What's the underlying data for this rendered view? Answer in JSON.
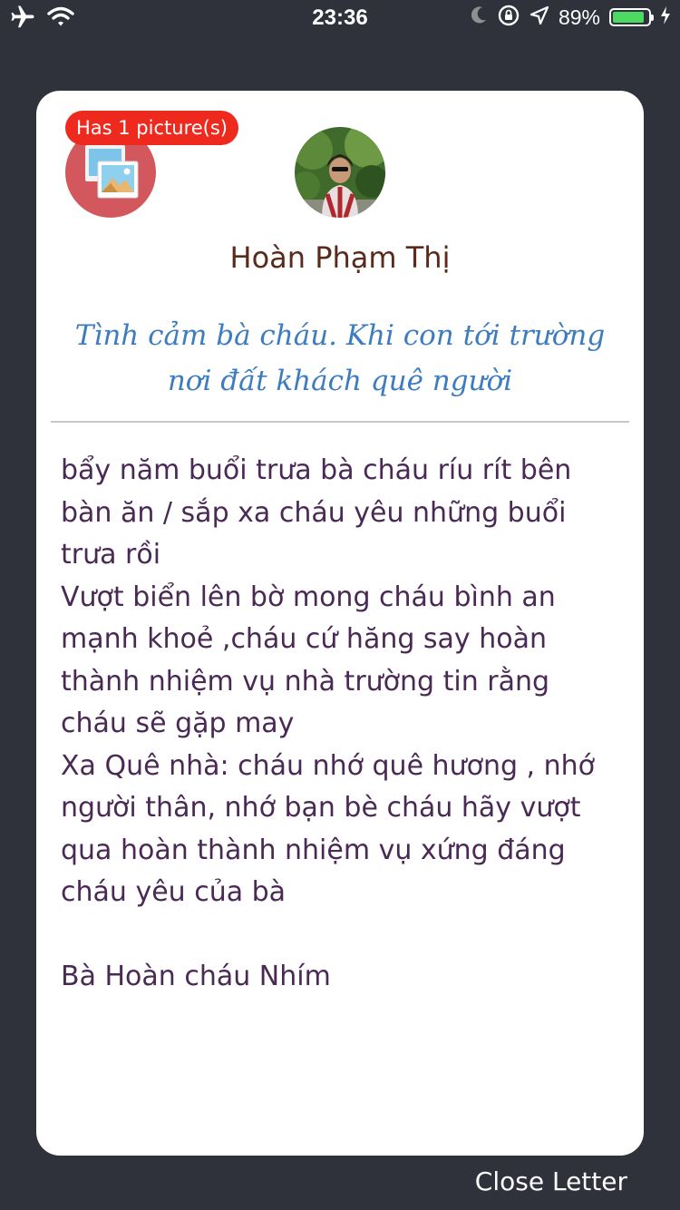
{
  "status_bar": {
    "time": "23:36",
    "battery_percent": "89%",
    "battery_level": 0.89,
    "icons": [
      "airplane-icon",
      "wifi-icon",
      "moon-icon",
      "orientation-lock-icon",
      "location-arrow-icon",
      "battery-icon",
      "charging-bolt-icon"
    ]
  },
  "letter": {
    "pictures_badge": "Has 1 picture(s)",
    "sender_name": "Hoàn Phạm Thị",
    "subject": "Tình cảm bà cháu. Khi con tới trường nơi đất khách quê người",
    "body": "bẩy năm buổi trưa bà cháu ríu rít bên bàn ăn / sắp xa cháu yêu những buổi trưa rồi\nVượt biển lên bờ mong cháu bình an mạnh khoẻ ,cháu cứ hăng say hoàn thành nhiệm vụ nhà trường tin rằng cháu sẽ gặp may\nXa Quê nhà: cháu nhớ quê hương , nhớ người thân, nhớ bạn bè cháu hãy vượt qua hoàn thành nhiệm vụ xứng đáng cháu yêu của bà\n\nBà Hoàn cháu Nhím"
  },
  "close_label": "Close Letter",
  "colors": {
    "background": "#2f313b",
    "card": "#ffffff",
    "badge": "#ee2a1f",
    "pictures_circle": "#d3585e",
    "sender_name": "#5a2a1a",
    "subject": "#3e7cc0",
    "body": "#4a2a55",
    "battery": "#4cd964"
  }
}
